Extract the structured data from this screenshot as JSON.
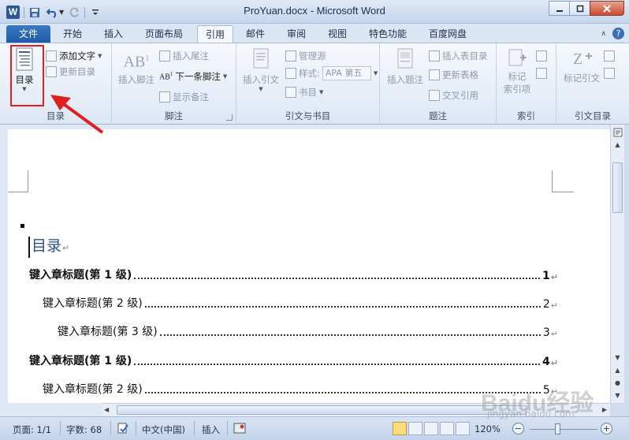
{
  "window": {
    "title": "ProYuan.docx  -  Microsoft Word",
    "app_icon": "W"
  },
  "ribbon_tabs": [
    {
      "label": "文件"
    },
    {
      "label": "开始"
    },
    {
      "label": "插入"
    },
    {
      "label": "页面布局"
    },
    {
      "label": "引用"
    },
    {
      "label": "邮件"
    },
    {
      "label": "审阅"
    },
    {
      "label": "视图"
    },
    {
      "label": "特色功能"
    },
    {
      "label": "百度网盘"
    }
  ],
  "active_tab": "引用",
  "ribbon": {
    "toc": {
      "big_button": "目录",
      "add_text": "添加文字",
      "update_toc": "更新目录",
      "group_label": "目录"
    },
    "footnotes": {
      "insert_footnote": "插入脚注",
      "insert_endnote": "插入尾注",
      "next_footnote": "下一条脚注",
      "show_notes": "显示备注",
      "group_label": "脚注",
      "ab_icon_text": "AB",
      "ab_icon_sup": "1"
    },
    "citations": {
      "insert_citation": "插入引文",
      "manage_sources": "管理源",
      "style_label": "样式:",
      "style_value": "APA 第五",
      "bibliography": "书目",
      "group_label": "引文与书目"
    },
    "captions": {
      "insert_caption": "插入题注",
      "insert_table_of_figures": "插入表目录",
      "update_table": "更新表格",
      "cross_reference": "交叉引用",
      "group_label": "题注"
    },
    "index": {
      "mark_entry_line1": "标记",
      "mark_entry_line2": "索引项",
      "group_label": "索引"
    },
    "authorities": {
      "mark_citation": "标记引文",
      "group_label": "引文目录"
    }
  },
  "document": {
    "toc_heading": "目录",
    "para_mark": "↵",
    "toc_entries": [
      {
        "text": "键入章标题(第  1  级)",
        "page": "1",
        "level": 1
      },
      {
        "text": "键入章标题(第  2  级)",
        "page": "2",
        "level": 2
      },
      {
        "text": "键入章标题(第  3  级)",
        "page": "3",
        "level": 3
      },
      {
        "text": "键入章标题(第  1  级)",
        "page": "4",
        "level": 1
      },
      {
        "text": "键入章标题(第  2  级)",
        "page": "5",
        "level": 2
      }
    ]
  },
  "status_bar": {
    "page": "页面: 1/1",
    "word_count": "字数: 68",
    "language": "中文(中国)",
    "insert_mode": "插入",
    "zoom": "120%"
  },
  "watermark": {
    "main": "Baidu经验",
    "sub": "jingyan.baidu.com"
  },
  "colors": {
    "annotation": "#e02020",
    "file_tab": "#2b63ae",
    "heading": "#2d4e8a"
  }
}
